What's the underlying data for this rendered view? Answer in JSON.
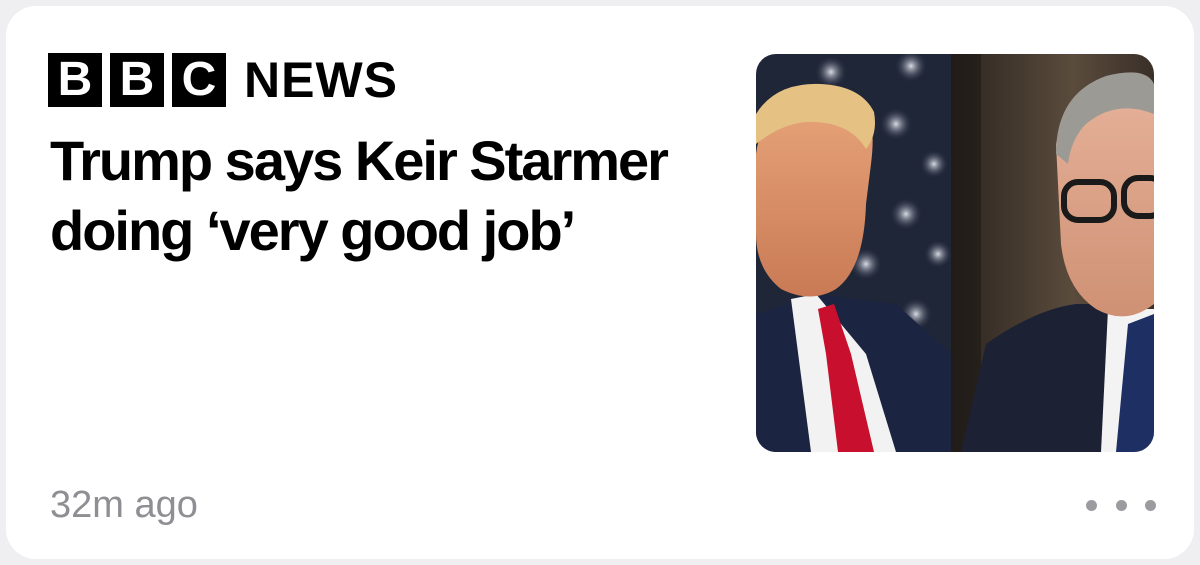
{
  "card": {
    "source": {
      "logo_letters": [
        "B",
        "B",
        "C"
      ],
      "logo_word": "NEWS"
    },
    "headline": "Trump says Keir Starmer doing ‘very good job’",
    "timestamp": "32m ago",
    "more_icon": "ellipsis-icon",
    "thumbnail": {
      "image_icon": "photo-thumbnail"
    }
  }
}
